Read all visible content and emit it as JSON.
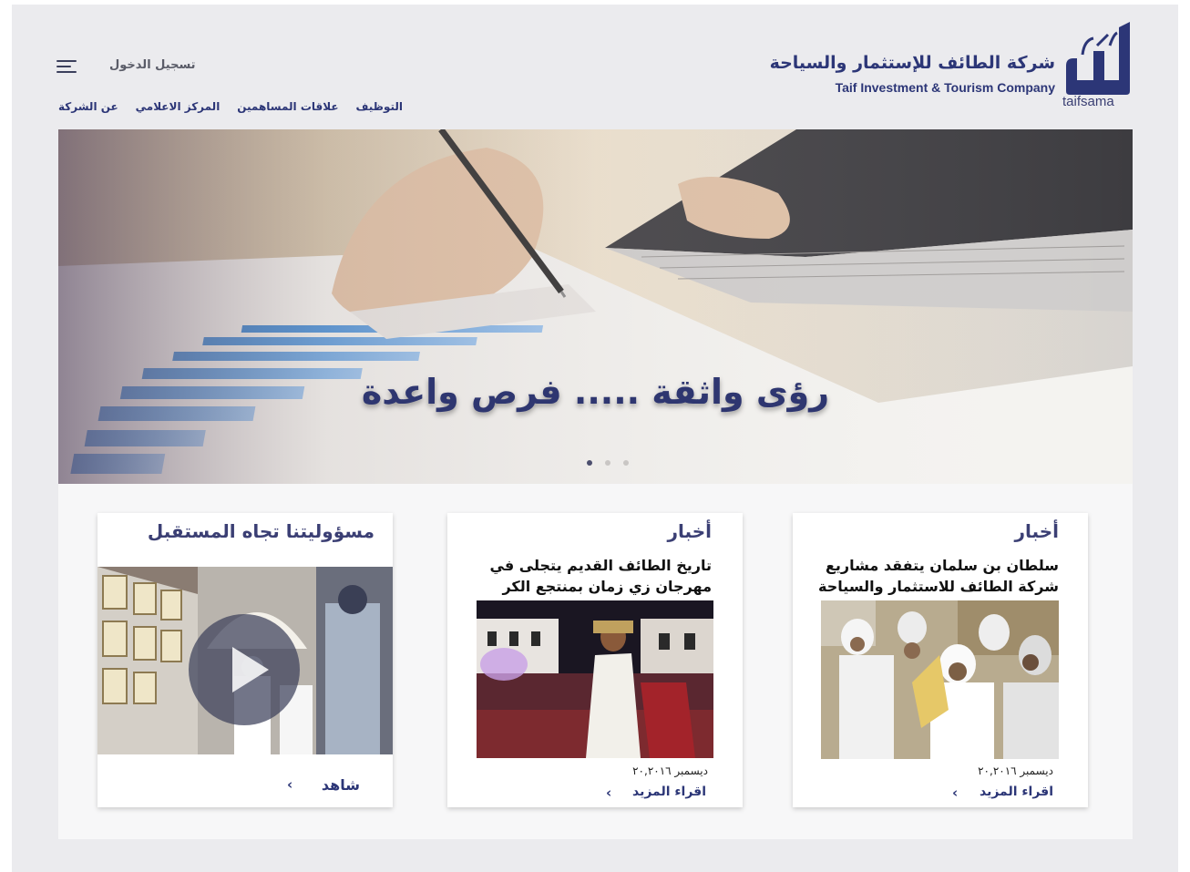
{
  "brand": {
    "name_ar": "شركة الطائف للإستثمار والسياحة",
    "name_en": "Taif Investment & Tourism Company",
    "logo_text": "taifsama",
    "primary_color": "#2c3677"
  },
  "header": {
    "login_label": "تسجيل الدخول",
    "menu_icon": "hamburger-menu-icon",
    "nav": [
      {
        "label": "عن الشركة"
      },
      {
        "label": "المركز الاعلامي"
      },
      {
        "label": "علاقات المساهمين"
      },
      {
        "label": "التوظيف"
      }
    ]
  },
  "hero": {
    "title": "رؤى واثقة ..... فرص واعدة",
    "slides": 3,
    "active_slide": 1
  },
  "cards": [
    {
      "heading": "أخبار",
      "headline": "سلطان بن سلمان يتفقد مشاريع شركة الطائف للاستثمار والسياحة",
      "date": "ديسمبر ٢٠,٢٠١٦",
      "link_label": "اقراء المزيد"
    },
    {
      "heading": "أخبار",
      "headline": "تاريخ الطائف القديم يتجلى في مهرجان زي زمان بمنتجع الكر",
      "date": "ديسمبر ٢٠,٢٠١٦",
      "link_label": "اقراء المزيد"
    },
    {
      "heading": "مسؤوليتنا تجاه المستقبل",
      "link_label": "شاهد",
      "video_icon": "play-icon"
    }
  ]
}
